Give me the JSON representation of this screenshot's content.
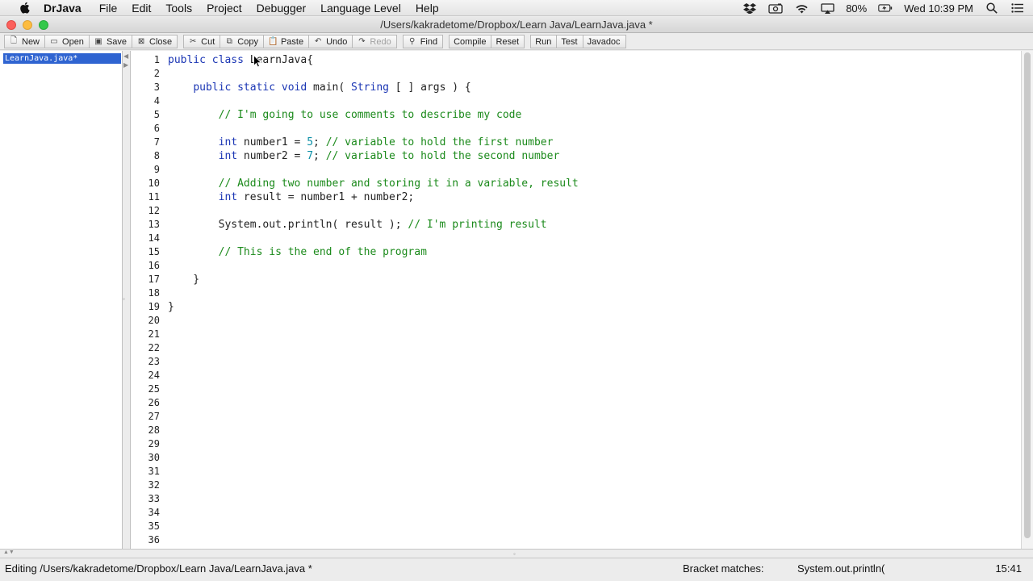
{
  "menubar": {
    "apple_glyph": "",
    "app_name": "DrJava",
    "items": [
      "File",
      "Edit",
      "Tools",
      "Project",
      "Debugger",
      "Language Level",
      "Help"
    ],
    "battery": "80%",
    "clock": "Wed 10:39 PM"
  },
  "window": {
    "title": "/Users/kakradetome/Dropbox/Learn Java/LearnJava.java *"
  },
  "toolbar": {
    "new": "New",
    "open": "Open",
    "save": "Save",
    "close": "Close",
    "cut": "Cut",
    "copy": "Copy",
    "paste": "Paste",
    "undo": "Undo",
    "redo": "Redo",
    "find": "Find",
    "compile": "Compile",
    "reset": "Reset",
    "run": "Run",
    "test": "Test",
    "javadoc": "Javadoc"
  },
  "documents": [
    "LearnJava.java*"
  ],
  "editor": {
    "lines": [
      "public class LearnJava{",
      "",
      "    public static void main( String [ ] args ) {",
      "",
      "        // I'm going to use comments to describe my code",
      "",
      "        int number1 = 5; // variable to hold the first number",
      "        int number2 = 7; // variable to hold the second number",
      "",
      "        // Adding two number and storing it in a variable, result",
      "        int result = number1 + number2;",
      "",
      "        System.out.println( result ); // I'm printing result",
      "",
      "        // This is the end of the program",
      "",
      "    }",
      "",
      "}",
      "",
      "",
      "",
      "",
      "",
      "",
      "",
      "",
      "",
      "",
      "",
      "",
      "",
      "",
      "",
      "",
      ""
    ]
  },
  "statusbar": {
    "editing": "Editing /Users/kakradetome/Dropbox/Learn Java/LearnJava.java *",
    "bracket_label": "Bracket matches:",
    "bracket_value": "System.out.println(",
    "position": "15:41"
  },
  "colors": {
    "keyword": "#1b36b4",
    "comment": "#1b8a1b",
    "number": "#0a8fa6",
    "selection": "#2f64d1"
  }
}
